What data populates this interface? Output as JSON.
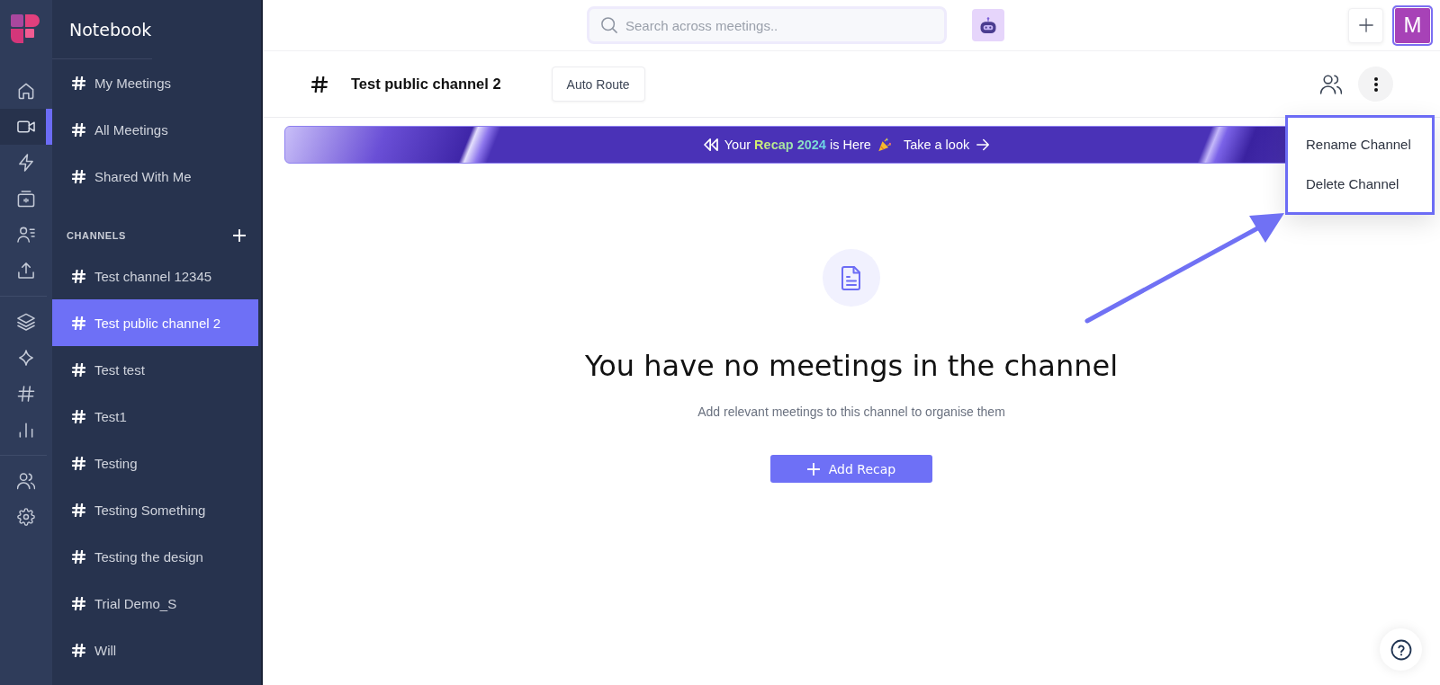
{
  "nav_rail": {
    "groups": [
      {
        "items": [
          {
            "selected": false
          },
          {
            "selected": true
          },
          {
            "selected": false
          },
          {
            "selected": false
          },
          {
            "selected": false
          },
          {
            "selected": false
          }
        ]
      },
      {
        "items": [
          {
            "selected": false
          },
          {
            "selected": false
          },
          {
            "selected": false
          },
          {
            "selected": false
          }
        ]
      },
      {
        "items": [
          {
            "selected": false
          },
          {
            "selected": false
          }
        ]
      }
    ]
  },
  "sidebar": {
    "title": "Notebook",
    "items": [
      {
        "label": "My Meetings",
        "selected": false
      },
      {
        "label": "All Meetings",
        "selected": false
      },
      {
        "label": "Shared With Me",
        "selected": false
      }
    ],
    "channels": {
      "heading": "CHANNELS",
      "items": [
        {
          "label": "Test channel 12345",
          "selected": false
        },
        {
          "label": "Test public channel 2",
          "selected": true
        },
        {
          "label": "Test test",
          "selected": false
        },
        {
          "label": "Test1",
          "selected": false
        },
        {
          "label": "Testing",
          "selected": false
        },
        {
          "label": "Testing Something",
          "selected": false
        },
        {
          "label": "Testing the design",
          "selected": false
        },
        {
          "label": "Trial Demo_S",
          "selected": false
        },
        {
          "label": "Will",
          "selected": false
        }
      ]
    }
  },
  "top_bar": {
    "search": {
      "placeholder": "Search across meetings.."
    },
    "avatar": {
      "initial": "M"
    }
  },
  "channel_header": {
    "title": "Test public channel 2",
    "auto_route_button": "Auto Route"
  },
  "banner": {
    "text": "Your **Recap 2024** is Here",
    "link": "Take a look"
  },
  "channel_menu": {
    "items": [
      "Rename Channel",
      "Delete Channel"
    ]
  },
  "empty_state": {
    "heading": "You have no meetings in the channel",
    "text": "Add relevant meetings to this channel to organise them",
    "button": "Add Recap"
  }
}
